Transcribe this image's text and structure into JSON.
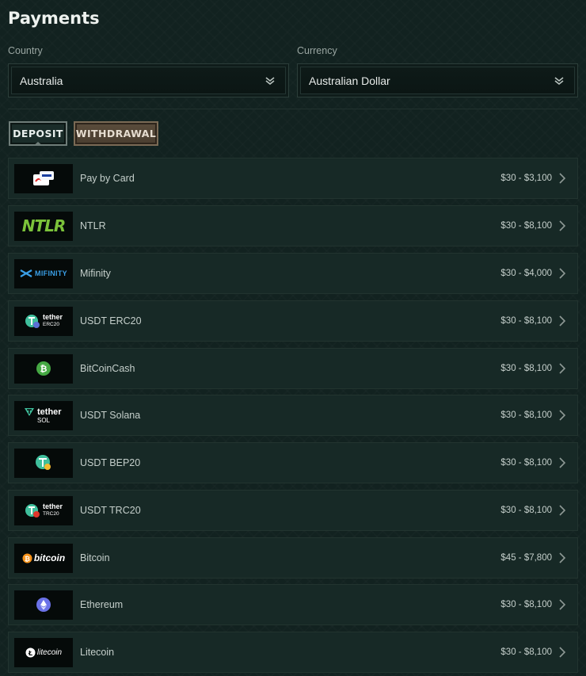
{
  "page": {
    "title": "Payments"
  },
  "country": {
    "label": "Country",
    "value": "Australia"
  },
  "currency": {
    "label": "Currency",
    "value": "Australian Dollar"
  },
  "tabs": [
    {
      "label": "DEPOSIT",
      "active": true
    },
    {
      "label": "WITHDRAWAL",
      "active": false
    }
  ],
  "methods": [
    {
      "name": "Pay by Card",
      "range": "$30 - $3,100",
      "icon": "card-icon"
    },
    {
      "name": "NTLR",
      "range": "$30 - $8,100",
      "icon": "ntlr-logo",
      "logo_text": "NTLR"
    },
    {
      "name": "Mifinity",
      "range": "$30 - $4,000",
      "icon": "mifinity-logo",
      "logo_text": "MIFINITY"
    },
    {
      "name": "USDT ERC20",
      "range": "$30 - $8,100",
      "icon": "tether-icon",
      "logo_text": "tether",
      "logo_sub": "ERC20"
    },
    {
      "name": "BitCoinCash",
      "range": "$30 - $8,100",
      "icon": "bitcoin-cash-icon"
    },
    {
      "name": "USDT Solana",
      "range": "$30 - $8,100",
      "icon": "tether-icon",
      "logo_text": "tether",
      "logo_sub": "SOL"
    },
    {
      "name": "USDT BEP20",
      "range": "$30 - $8,100",
      "icon": "tether-bep20-icon"
    },
    {
      "name": "USDT TRC20",
      "range": "$30 - $8,100",
      "icon": "tether-icon",
      "logo_text": "tether",
      "logo_sub": "TRC20"
    },
    {
      "name": "Bitcoin",
      "range": "$45 - $7,800",
      "icon": "bitcoin-logo",
      "logo_text": "bitcoin"
    },
    {
      "name": "Ethereum",
      "range": "$30 - $8,100",
      "icon": "ethereum-icon"
    },
    {
      "name": "Litecoin",
      "range": "$30 - $8,100",
      "icon": "litecoin-logo",
      "logo_text": "litecoin"
    }
  ],
  "colors": {
    "background": "#122220",
    "row": "#172926",
    "withdrawal_tab": "#5a4c3b",
    "ntlr_green": "#7bc23a",
    "mifinity_blue": "#3aa0e8",
    "tether_green": "#3fbf9c",
    "bch_green": "#45a843",
    "bitcoin_orange": "#f7931a",
    "ethereum_purple": "#6b72e8"
  }
}
